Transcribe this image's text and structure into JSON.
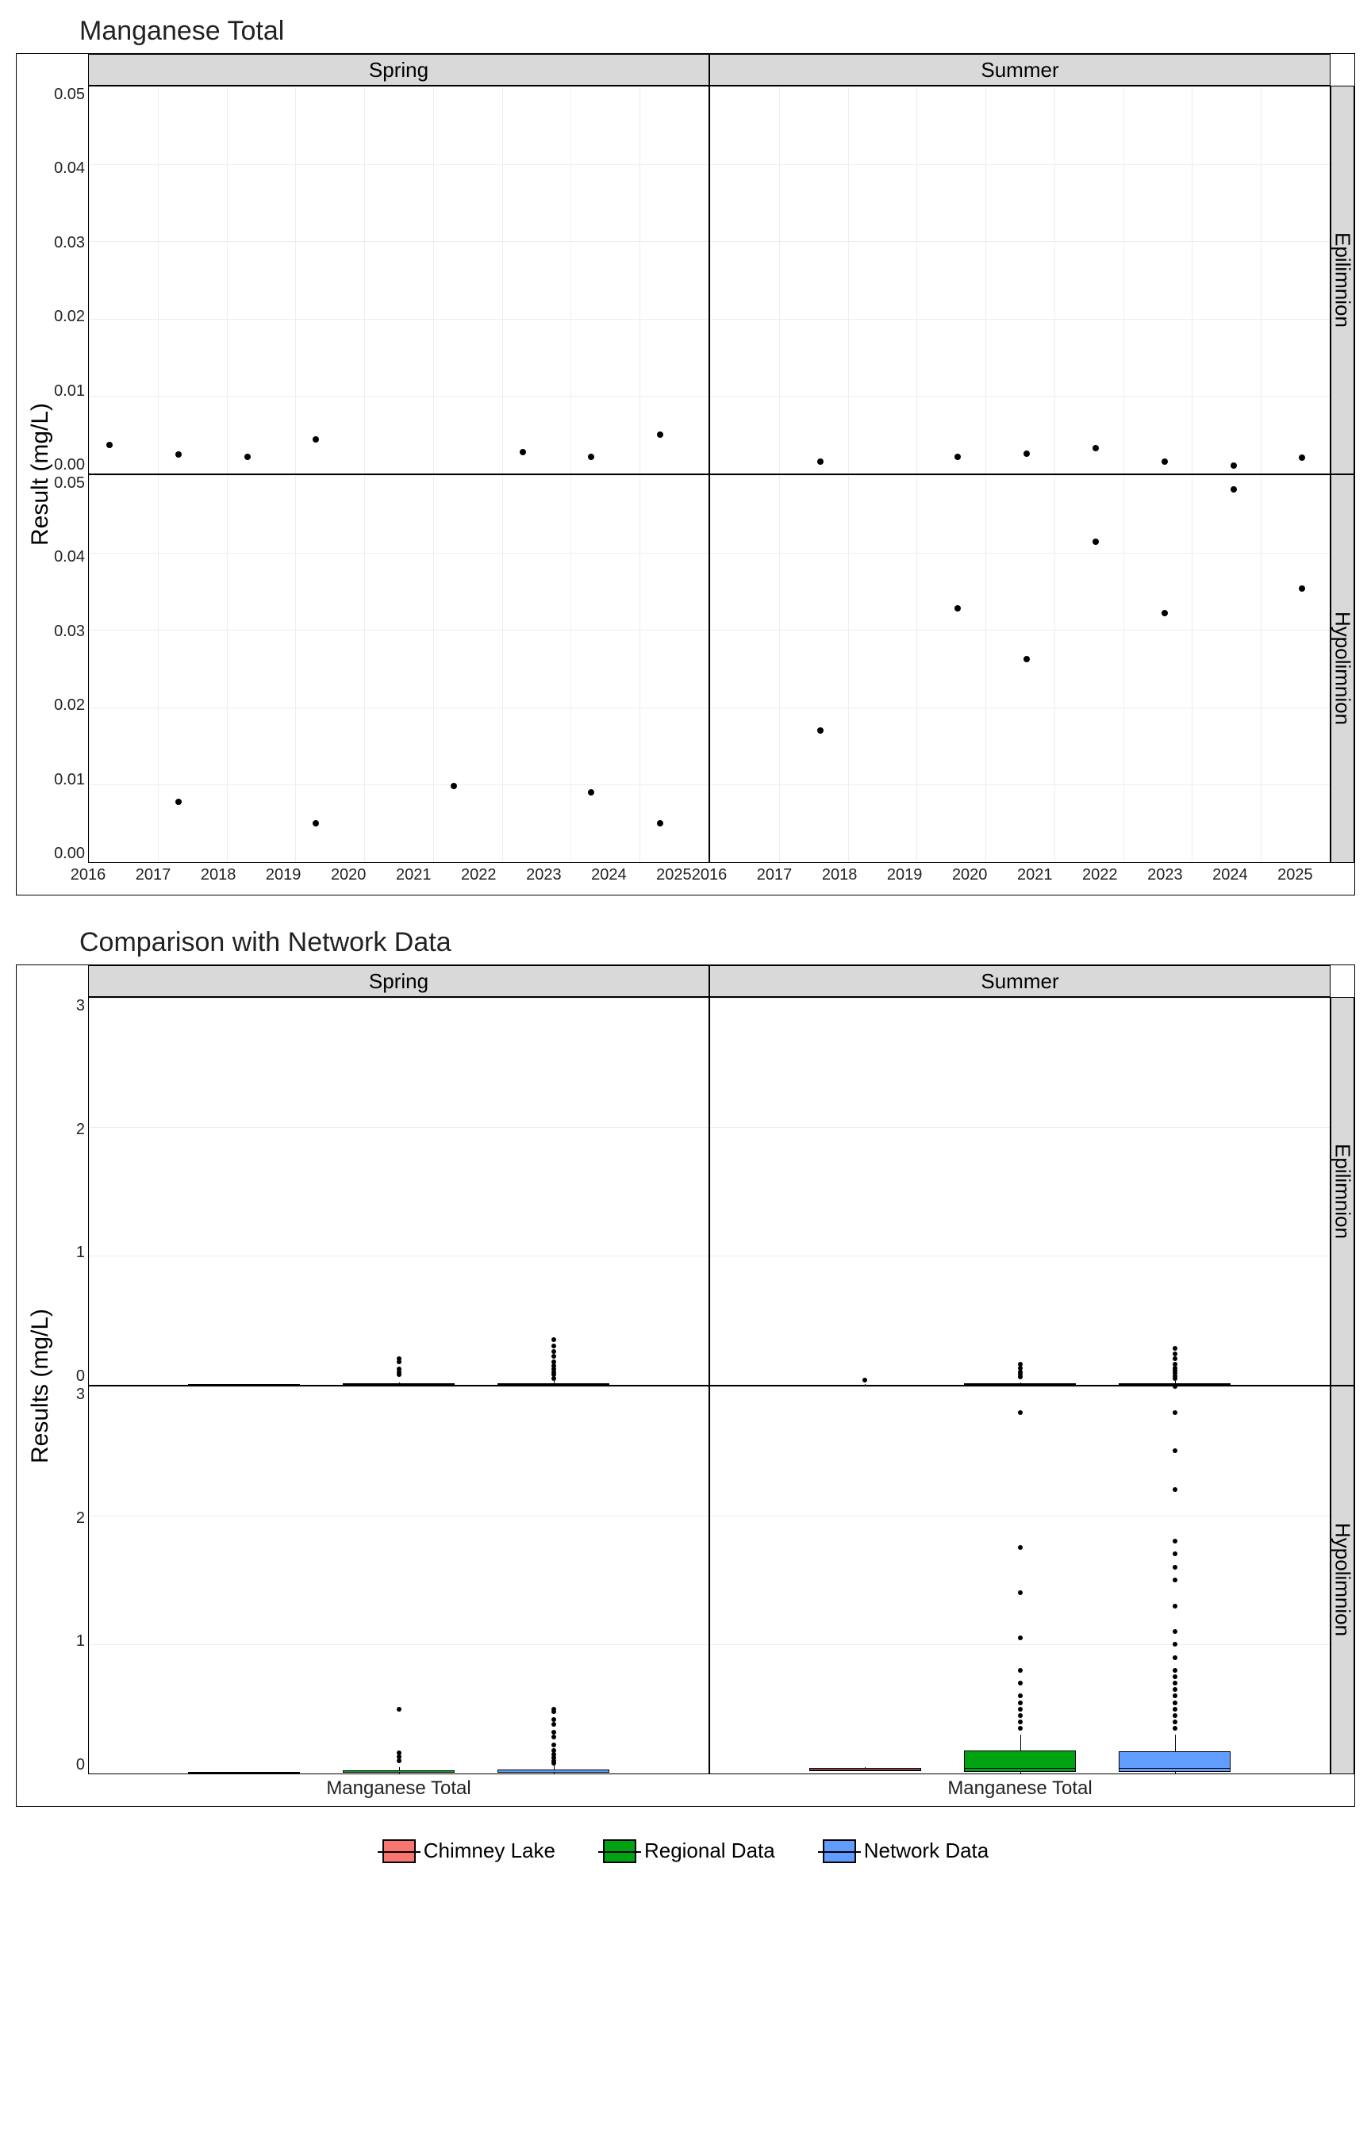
{
  "chart_data": [
    {
      "type": "scatter",
      "title": "Manganese Total",
      "ylabel": "Result (mg/L)",
      "xlabel": "",
      "ylim": [
        0,
        0.05
      ],
      "xlim": [
        2016,
        2025
      ],
      "x_ticks": [
        "2016",
        "2017",
        "2018",
        "2019",
        "2020",
        "2021",
        "2022",
        "2023",
        "2024",
        "2025"
      ],
      "y_ticks": [
        "0.00",
        "0.01",
        "0.02",
        "0.03",
        "0.04",
        "0.05"
      ],
      "col_facets": [
        "Spring",
        "Summer"
      ],
      "row_facets": [
        "Epilimnion",
        "Hypolimnion"
      ],
      "panels": {
        "Spring_Epilimnion": {
          "x": [
            2016.3,
            2017.3,
            2018.3,
            2019.3,
            2022.3,
            2023.3,
            2024.3
          ],
          "y": [
            0.0037,
            0.0025,
            0.0022,
            0.0044,
            0.0028,
            0.0022,
            0.005
          ]
        },
        "Summer_Epilimnion": {
          "x": [
            2017.6,
            2019.6,
            2020.6,
            2021.6,
            2022.6,
            2023.6,
            2024.6
          ],
          "y": [
            0.0015,
            0.0022,
            0.0026,
            0.0033,
            0.0015,
            0.001,
            0.002
          ]
        },
        "Spring_Hypolimnion": {
          "x": [
            2017.3,
            2019.3,
            2021.3,
            2023.3,
            2024.3
          ],
          "y": [
            0.0078,
            0.005,
            0.0098,
            0.009,
            0.005
          ]
        },
        "Summer_Hypolimnion": {
          "x": [
            2017.6,
            2019.6,
            2020.6,
            2021.6,
            2022.6,
            2023.6,
            2024.6
          ],
          "y": [
            0.017,
            0.0328,
            0.0262,
            0.0414,
            0.0322,
            0.0482,
            0.0353
          ]
        }
      }
    },
    {
      "type": "box",
      "title": "Comparison with Network Data",
      "ylabel": "Results (mg/L)",
      "xlabel": "",
      "ylim": [
        0,
        3
      ],
      "x_category": "Manganese Total",
      "y_ticks": [
        "0",
        "1",
        "2",
        "3"
      ],
      "col_facets": [
        "Spring",
        "Summer"
      ],
      "row_facets": [
        "Epilimnion",
        "Hypolimnion"
      ],
      "series": [
        "Chimney Lake",
        "Regional Data",
        "Network Data"
      ],
      "colors": {
        "Chimney Lake": "#f8766d",
        "Regional Data": "#00a413",
        "Network Data": "#619cff"
      },
      "panels": {
        "Spring_Epilimnion": {
          "Chimney Lake": {
            "box": [
              0.002,
              0.003,
              0.005
            ],
            "whisker": [
              0.001,
              0.006
            ],
            "outliers": []
          },
          "Regional Data": {
            "box": [
              0.003,
              0.006,
              0.012
            ],
            "whisker": [
              0.001,
              0.02
            ],
            "outliers": [
              0.08,
              0.1,
              0.12,
              0.18,
              0.2
            ]
          },
          "Network Data": {
            "box": [
              0.003,
              0.006,
              0.015
            ],
            "whisker": [
              0.001,
              0.03
            ],
            "outliers": [
              0.05,
              0.08,
              0.1,
              0.12,
              0.15,
              0.18,
              0.22,
              0.26,
              0.3,
              0.35
            ]
          }
        },
        "Summer_Epilimnion": {
          "Chimney Lake": {
            "box": [
              0.001,
              0.002,
              0.003
            ],
            "whisker": [
              0.001,
              0.004
            ],
            "outliers": [
              0.04
            ]
          },
          "Regional Data": {
            "box": [
              0.003,
              0.006,
              0.012
            ],
            "whisker": [
              0.001,
              0.02
            ],
            "outliers": [
              0.06,
              0.08,
              0.1,
              0.13,
              0.16
            ]
          },
          "Network Data": {
            "box": [
              0.003,
              0.007,
              0.015
            ],
            "whisker": [
              0.001,
              0.03
            ],
            "outliers": [
              0.05,
              0.07,
              0.09,
              0.11,
              0.13,
              0.16,
              0.2,
              0.24,
              0.28
            ]
          }
        },
        "Spring_Hypolimnion": {
          "Chimney Lake": {
            "box": [
              0.005,
              0.008,
              0.01
            ],
            "whisker": [
              0.005,
              0.01
            ],
            "outliers": []
          },
          "Regional Data": {
            "box": [
              0.005,
              0.01,
              0.025
            ],
            "whisker": [
              0.002,
              0.05
            ],
            "outliers": [
              0.1,
              0.13,
              0.16,
              0.5
            ]
          },
          "Network Data": {
            "box": [
              0.005,
              0.012,
              0.03
            ],
            "whisker": [
              0.002,
              0.06
            ],
            "outliers": [
              0.08,
              0.1,
              0.12,
              0.15,
              0.18,
              0.22,
              0.28,
              0.32,
              0.38,
              0.42,
              0.48,
              0.5
            ]
          }
        },
        "Summer_Hypolimnion": {
          "Chimney Lake": {
            "box": [
              0.017,
              0.033,
              0.041
            ],
            "whisker": [
              0.017,
              0.048
            ],
            "outliers": []
          },
          "Regional Data": {
            "box": [
              0.01,
              0.04,
              0.18
            ],
            "whisker": [
              0.002,
              0.3
            ],
            "outliers": [
              0.35,
              0.4,
              0.45,
              0.5,
              0.55,
              0.6,
              0.7,
              0.8,
              1.05,
              1.4,
              1.75,
              2.8
            ]
          },
          "Network Data": {
            "box": [
              0.01,
              0.04,
              0.17
            ],
            "whisker": [
              0.002,
              0.3
            ],
            "outliers": [
              0.35,
              0.4,
              0.45,
              0.5,
              0.55,
              0.6,
              0.65,
              0.7,
              0.75,
              0.8,
              0.9,
              1.0,
              1.1,
              1.3,
              1.5,
              1.6,
              1.7,
              1.8,
              2.2,
              2.5,
              2.8,
              3.0
            ]
          }
        }
      }
    }
  ],
  "legend": {
    "items": [
      {
        "label": "Chimney Lake",
        "color": "#f8766d"
      },
      {
        "label": "Regional Data",
        "color": "#00a413"
      },
      {
        "label": "Network Data",
        "color": "#619cff"
      }
    ]
  }
}
